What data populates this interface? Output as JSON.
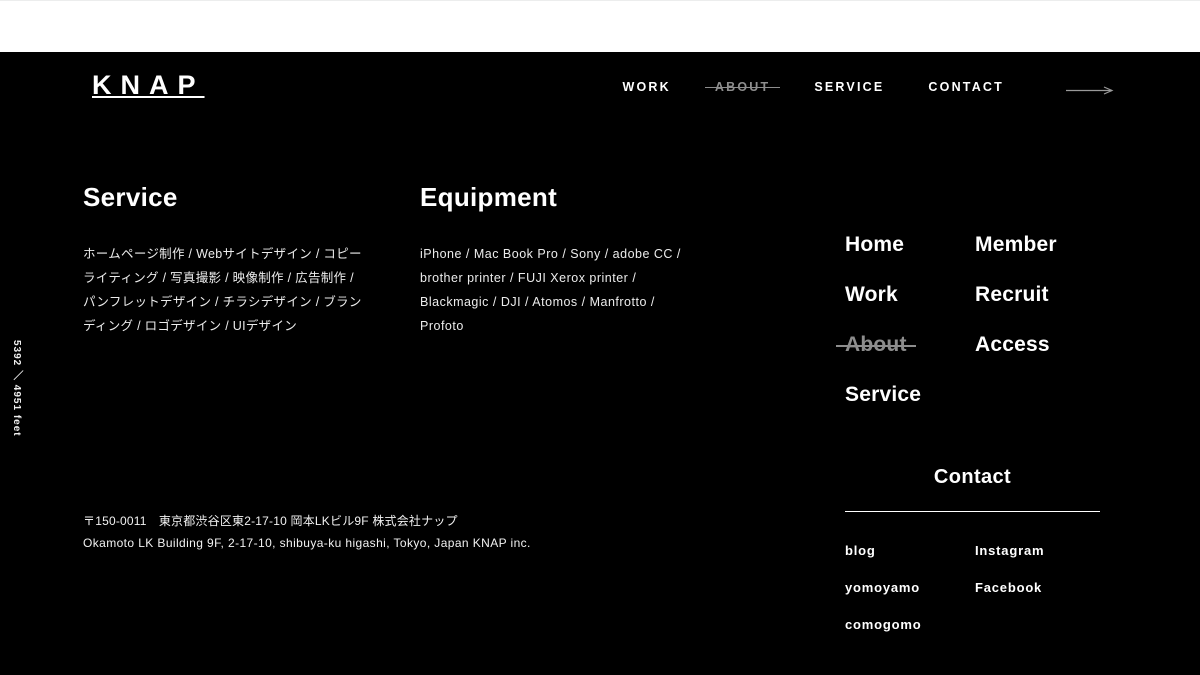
{
  "colors": {
    "background": "#000000",
    "top_band": "#ffffff",
    "text": "#ffffff",
    "muted": "#8d8d8d",
    "body_text": "#ececec"
  },
  "header": {
    "brand": "KNAP",
    "nav": [
      {
        "label": "WORK",
        "current": false
      },
      {
        "label": "ABOUT",
        "current": true
      },
      {
        "label": "SERVICE",
        "current": false
      },
      {
        "label": "CONTACT",
        "current": false
      }
    ],
    "arrow_icon": "arrow-right-icon"
  },
  "scroll_meter": {
    "text": "5392 ／ 4951 feet"
  },
  "service": {
    "heading": "Service",
    "body": "ホームページ制作 / Webサイトデザイン / コピーライティング / 写真撮影 / 映像制作 / 広告制作 / パンフレットデザイン / チラシデザイン / ブランディング / ロゴデザイン / UIデザイン"
  },
  "equipment": {
    "heading": "Equipment",
    "body": "iPhone / Mac Book Pro / Sony / adobe CC / brother printer / FUJI Xerox printer / Blackmagic / DJI / Atomos / Manfrotto / Profoto"
  },
  "address": {
    "line_jp": "〒150-0011　東京都渋谷区東2-17-10 岡本LKビル9F 株式会社ナップ",
    "line_en": "Okamoto LK Building 9F, 2-17-10, shibuya-ku higashi, Tokyo, Japan KNAP inc."
  },
  "footer_nav": {
    "left": [
      {
        "label": "Home",
        "current": false
      },
      {
        "label": "Work",
        "current": false
      },
      {
        "label": "About",
        "current": true
      },
      {
        "label": "Service",
        "current": false
      }
    ],
    "right": [
      {
        "label": "Member",
        "current": false
      },
      {
        "label": "Recruit",
        "current": false
      },
      {
        "label": "Access",
        "current": false
      }
    ]
  },
  "contact": {
    "title": "Contact",
    "social_left": [
      {
        "label": "blog"
      },
      {
        "label": "yomoyamo"
      },
      {
        "label": "comogomo"
      }
    ],
    "social_right": [
      {
        "label": "Instagram"
      },
      {
        "label": "Facebook"
      }
    ]
  }
}
